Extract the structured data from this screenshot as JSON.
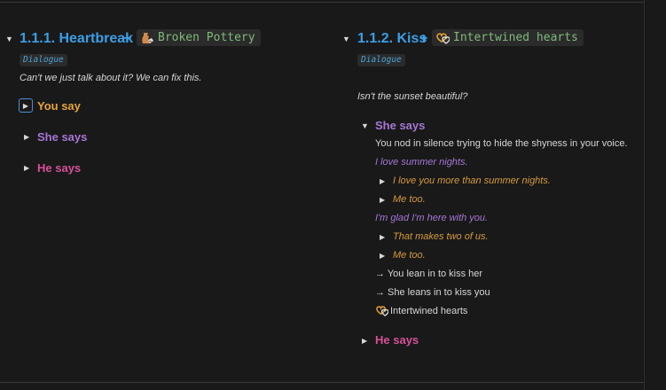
{
  "left": {
    "heading": "1.1.1. Heartbreak",
    "plus": "+",
    "item_chip": "Broken Pottery",
    "item_icon": "broken-pottery-icon",
    "tag": "Dialogue",
    "line": "Can't we just talk about it? We can fix this.",
    "options": [
      {
        "label": "You say",
        "color": "#e6a33c"
      },
      {
        "label": "She says",
        "color": "#a676d6"
      },
      {
        "label": "He says",
        "color": "#d6509a"
      }
    ]
  },
  "right": {
    "heading": "1.1.2. Kiss",
    "plus": "+",
    "item_chip": "Intertwined hearts",
    "item_icon": "intertwined-hearts-icon",
    "tag": "Dialogue",
    "line": "Isn't the sunset beautiful?",
    "she_says": {
      "label": "She says",
      "narration": "You nod in silence trying to hide the shyness in your voice.",
      "line1": "I love summer nights.",
      "reply1a": "I love you more than summer nights.",
      "reply1b": "Me too.",
      "line2": "I'm glad I'm here with you.",
      "reply2a": "That makes two of us.",
      "reply2b": "Me too.",
      "action1": "→ You lean in to kiss her",
      "action2": "→ She leans in to kiss you",
      "reward": "Intertwined hearts"
    },
    "he_says": {
      "label": "He says"
    }
  },
  "colors": {
    "background": "#191919",
    "heading_blue": "#3c9ee6",
    "chip_text": "#7fb97a",
    "you_orange": "#e6a33c",
    "she_purple": "#a676d6",
    "he_pink": "#d6509a"
  }
}
